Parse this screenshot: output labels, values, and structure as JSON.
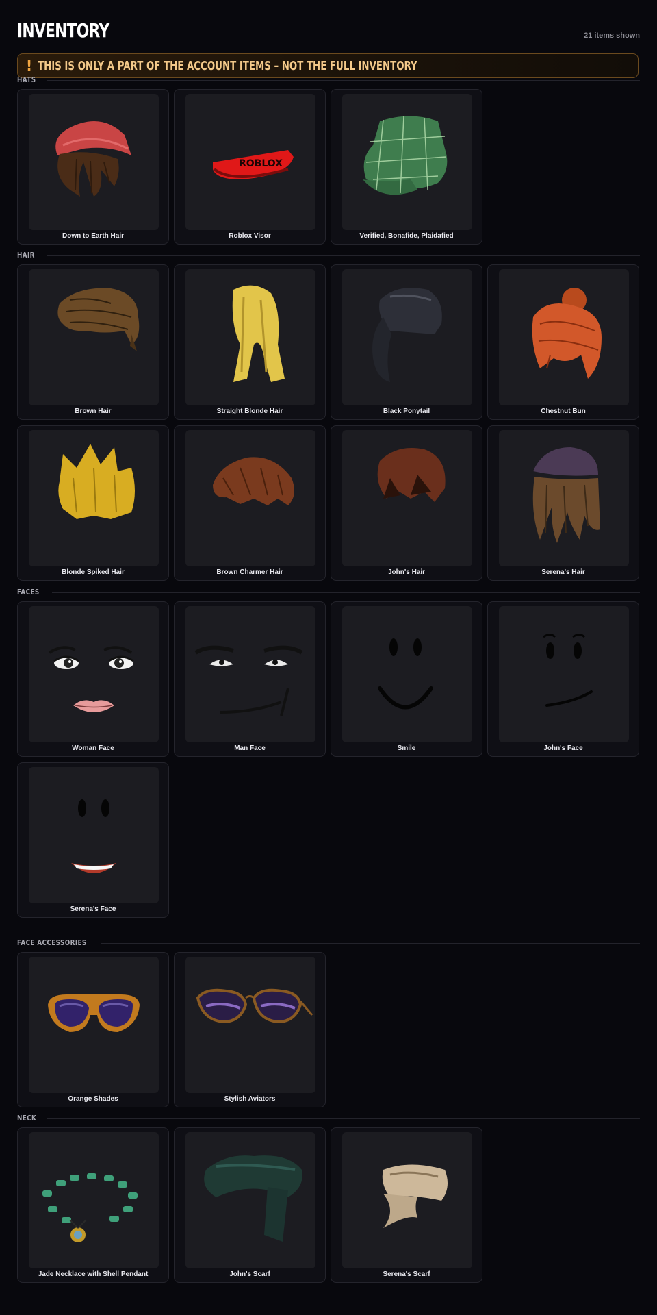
{
  "header": {
    "title": "INVENTORY",
    "count": "21 items shown"
  },
  "banner": {
    "icon": "exclamation-icon",
    "icon_glyph": "!",
    "text": "THIS IS ONLY A PART OF THE ACCOUNT ITEMS – NOT THE FULL INVENTORY"
  },
  "sections": [
    {
      "label": "HATS",
      "items": [
        {
          "name": "Down to Earth Hair",
          "icon": "hair-with-red-beanie-icon"
        },
        {
          "name": "Roblox Visor",
          "icon": "red-visor-icon"
        },
        {
          "name": "Verified, Bonafide, Plaidafied",
          "icon": "green-plaid-cap-icon"
        }
      ]
    },
    {
      "label": "HAIR",
      "items": [
        {
          "name": "Brown Hair",
          "icon": "brown-hair-icon"
        },
        {
          "name": "Straight Blonde Hair",
          "icon": "blonde-hair-icon"
        },
        {
          "name": "Black Ponytail",
          "icon": "black-ponytail-icon"
        },
        {
          "name": "Chestnut Bun",
          "icon": "chestnut-bun-icon"
        },
        {
          "name": "Blonde Spiked Hair",
          "icon": "blonde-spiked-hair-icon"
        },
        {
          "name": "Brown Charmer Hair",
          "icon": "brown-charmer-hair-icon"
        },
        {
          "name": "John's Hair",
          "icon": "johns-hair-icon"
        },
        {
          "name": "Serena's Hair",
          "icon": "serenas-hair-icon"
        }
      ]
    },
    {
      "label": "FACES",
      "items": [
        {
          "name": "Woman Face",
          "icon": "woman-face-icon"
        },
        {
          "name": "Man Face",
          "icon": "man-face-icon"
        },
        {
          "name": "Smile",
          "icon": "smile-face-icon"
        },
        {
          "name": "John's Face",
          "icon": "johns-face-icon"
        },
        {
          "name": "Serena's Face",
          "icon": "serenas-face-icon"
        }
      ]
    },
    {
      "label": "FACE ACCESSORIES",
      "items": [
        {
          "name": "Orange Shades",
          "icon": "orange-shades-icon"
        },
        {
          "name": "Stylish Aviators",
          "icon": "aviator-sunglasses-icon"
        }
      ]
    },
    {
      "label": "NECK",
      "items": [
        {
          "name": "Jade Necklace with Shell Pendant",
          "icon": "jade-necklace-icon"
        },
        {
          "name": "John's Scarf",
          "icon": "dark-green-scarf-icon"
        },
        {
          "name": "Serena's Scarf",
          "icon": "beige-scarf-icon"
        }
      ]
    }
  ],
  "visor_text": "ROBLOX",
  "colors": {
    "background": "#08080d",
    "card": "#0f0f15",
    "thumb": "#1c1c21",
    "banner_accent": "#f0a642",
    "banner_text": "#f3c98a"
  }
}
